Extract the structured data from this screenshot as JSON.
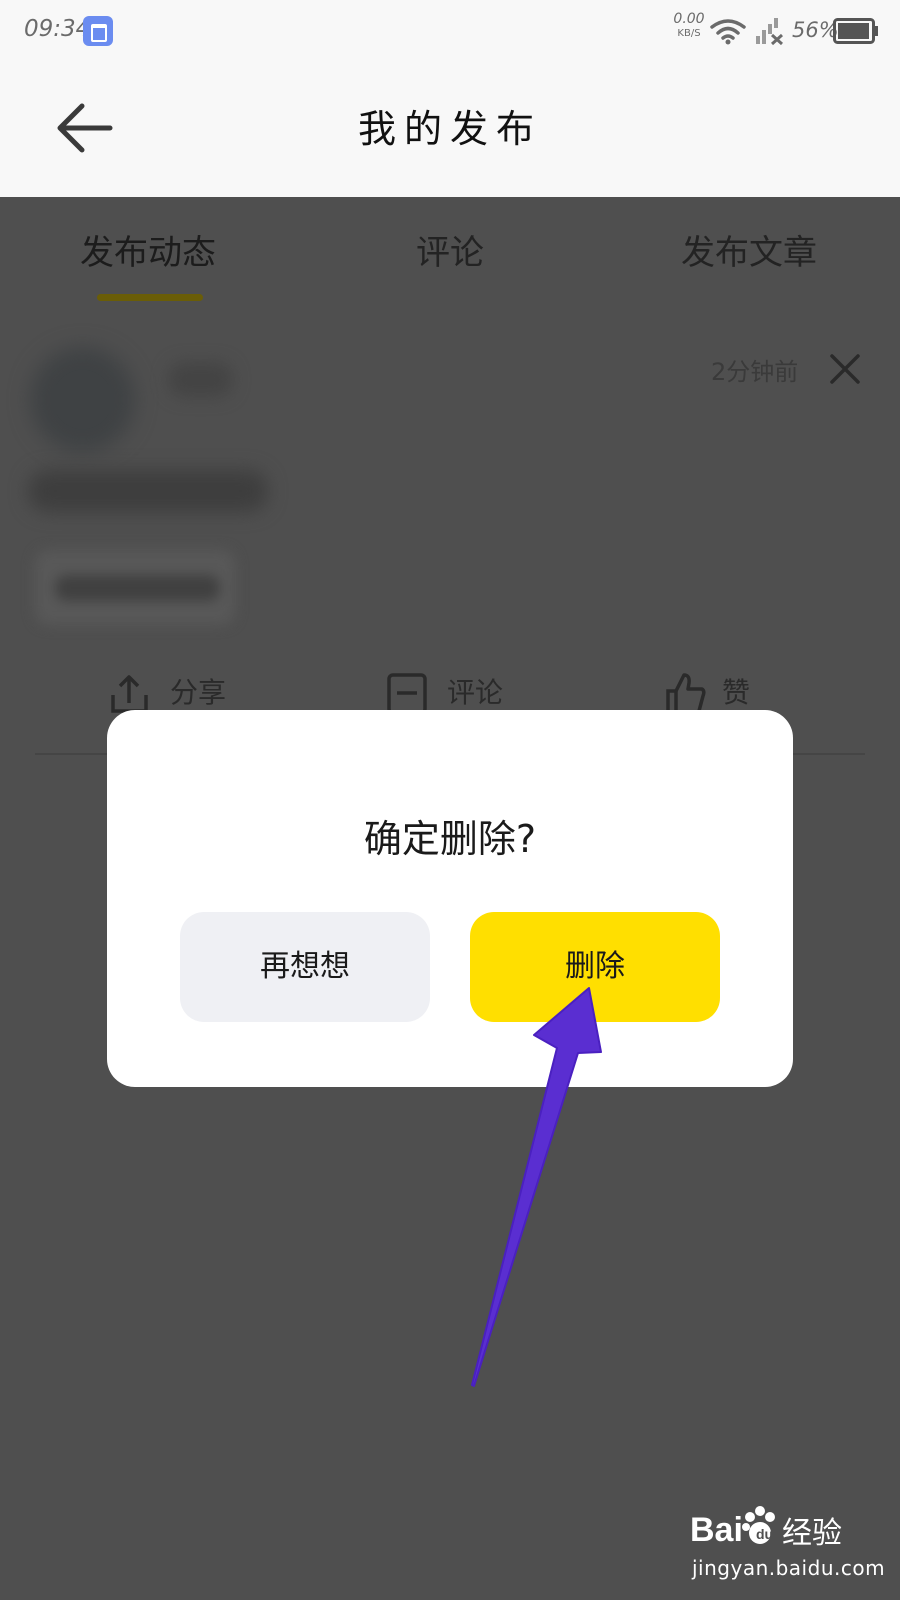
{
  "status_bar": {
    "time": "09:34",
    "net_speed_value": "0.00",
    "net_speed_unit": "KB/S",
    "battery_percent": "56%",
    "icons": [
      "app-notification-icon",
      "wifi-icon",
      "signal-no-service-icon",
      "battery-icon"
    ]
  },
  "header": {
    "title": "我的发布",
    "back_icon": "arrow-left-icon"
  },
  "tabs": [
    {
      "label": "发布动态",
      "active": true
    },
    {
      "label": "评论",
      "active": false
    },
    {
      "label": "发布文章",
      "active": false
    }
  ],
  "post": {
    "time": "2分钟前",
    "close_icon": "close-icon",
    "actions": [
      {
        "label": "分享",
        "icon": "share-icon"
      },
      {
        "label": "评论",
        "icon": "comment-icon"
      },
      {
        "label": "赞",
        "icon": "thumbs-up-icon"
      }
    ]
  },
  "dialog": {
    "title": "确定删除?",
    "cancel_label": "再想想",
    "confirm_label": "删除"
  },
  "watermark": {
    "logo_text": "Baidu经验",
    "url": "jingyan.baidu.com"
  },
  "colors": {
    "overlay": "#4f4f4f",
    "accent_yellow": "#ffdf00",
    "cancel_bg": "#eff0f4",
    "annotation_arrow": "#5a2ed1"
  }
}
